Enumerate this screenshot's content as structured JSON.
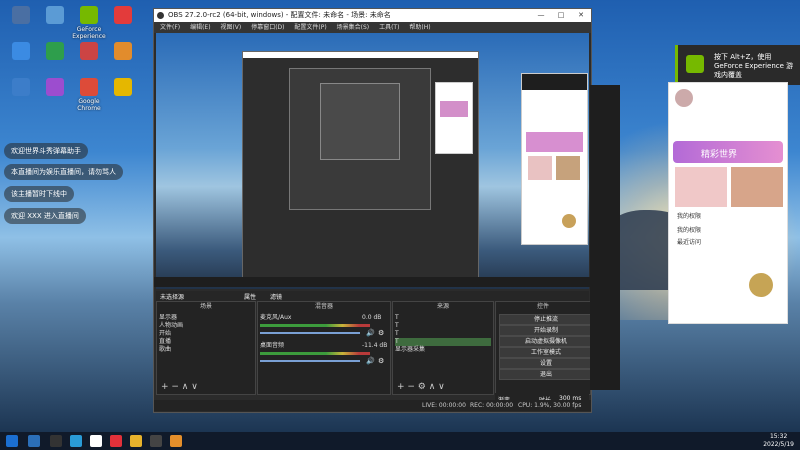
{
  "desktop_icons": [
    {
      "label": "",
      "icon": "recycle-bin-icon"
    },
    {
      "label": "",
      "icon": "app-icon"
    },
    {
      "label": "GeForce Experience",
      "icon": "geforce-icon"
    },
    {
      "label": "",
      "icon": "app-icon"
    },
    {
      "label": "",
      "icon": "app-icon"
    },
    {
      "label": "",
      "icon": "app-icon"
    },
    {
      "label": "",
      "icon": "app-icon"
    },
    {
      "label": "",
      "icon": "app-icon"
    },
    {
      "label": "",
      "icon": "app-icon"
    },
    {
      "label": "",
      "icon": "app-icon"
    },
    {
      "label": "Google Chrome",
      "icon": "chrome-icon"
    },
    {
      "label": "",
      "icon": "app-icon"
    }
  ],
  "chat_bubbles": [
    "欢迎世界斗秀弹幕助手",
    "本直播间为娱乐直播间，请勿骂人",
    "该主播暂时下线中",
    "欢迎 XXX 进入直播间"
  ],
  "obs": {
    "title": "OBS 27.2.0-rc2 (64-bit, windows) - 配置文件: 未命名 - 场景: 未命名",
    "menu": [
      "文件(F)",
      "编辑(E)",
      "视图(V)",
      "停靠窗口(D)",
      "配置文件(P)",
      "场景集合(S)",
      "工具(T)",
      "帮助(H)"
    ],
    "scene_label": "未选择源",
    "props_btn": "属性",
    "filters_btn": "滤镜",
    "docks": {
      "scenes": {
        "header": "场景",
        "items": [
          "显示器",
          "人物动画",
          "开始",
          "直播",
          "歌曲"
        ]
      },
      "sources": {
        "header": "来源",
        "items": [
          "",
          "",
          "",
          "",
          "显示器采集"
        ]
      },
      "mixer": {
        "header": "混音器",
        "tracks": [
          {
            "name": "麦克风/Aux",
            "db": "0.0 dB"
          },
          {
            "name": "桌面音频",
            "db": "-11.4 dB"
          }
        ]
      },
      "transitions": {
        "header": "场景过渡",
        "type": "渐变",
        "duration_label": "时长",
        "duration": "300 ms"
      },
      "controls": {
        "header": "控件",
        "buttons": [
          "停止推流",
          "开始录制",
          "启动虚拟摄像机",
          "工作室模式",
          "设置",
          "退出"
        ]
      }
    },
    "status": {
      "live": "LIVE: 00:00:00",
      "rec": "REC: 00:00:00",
      "cpu": "CPU: 1.9%, 30.00 fps"
    }
  },
  "gfx_toast": "按下 Alt+Z，使用 GeForce Experience 游戏内覆盖",
  "live_panel": {
    "title": "精彩世界",
    "items": [
      "我的权限",
      "我的权限",
      "最近访问"
    ]
  },
  "taskbar": {
    "time": "15:32",
    "date": "2022/5/19"
  }
}
